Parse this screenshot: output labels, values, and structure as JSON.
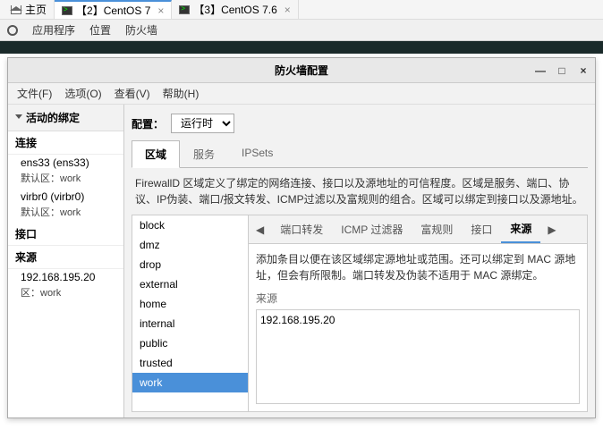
{
  "host_tabs": {
    "home": "主页",
    "tab1": "【2】CentOS 7",
    "tab2": "【3】CentOS 7.6"
  },
  "gnome": {
    "apps": "应用程序",
    "places": "位置",
    "firewall": "防火墙"
  },
  "window": {
    "title": "防火墙配置",
    "menu": {
      "file": "文件(F)",
      "options": "选项(O)",
      "view": "查看(V)",
      "help": "帮助(H)"
    }
  },
  "left": {
    "header": "活动的绑定",
    "connections": "连接",
    "items": [
      {
        "name": "ens33 (ens33)",
        "zone": "默认区：work"
      },
      {
        "name": "virbr0 (virbr0)",
        "zone": "默认区：work"
      }
    ],
    "interfaces": "接口",
    "sources": "来源",
    "src_ip": "192.168.195.20",
    "src_zone": "区：work"
  },
  "config": {
    "label": "配置：",
    "value": "运行时"
  },
  "zone_tabs": {
    "zones": "区域",
    "services": "服务",
    "ipsets": "IPSets"
  },
  "zone_desc": "FirewallD 区域定义了绑定的网络连接、接口以及源地址的可信程度。区域是服务、端口、协议、IP伪装、端口/报文转发、ICMP过滤以及富规则的组合。区域可以绑定到接口以及源地址。",
  "zones": [
    "block",
    "dmz",
    "drop",
    "external",
    "home",
    "internal",
    "public",
    "trusted",
    "work"
  ],
  "zone_selected": "work",
  "sub_tabs": {
    "port_fwd": "端口转发",
    "icmp": "ICMP 过滤器",
    "rich": "富规则",
    "iface": "接口",
    "src": "来源"
  },
  "detail_desc": "添加条目以便在该区域绑定源地址或范围。还可以绑定到 MAC 源地址，但会有所限制。端口转发及伪装不适用于 MAC 源绑定。",
  "src_header": "来源",
  "src_entries": [
    "192.168.195.20"
  ]
}
